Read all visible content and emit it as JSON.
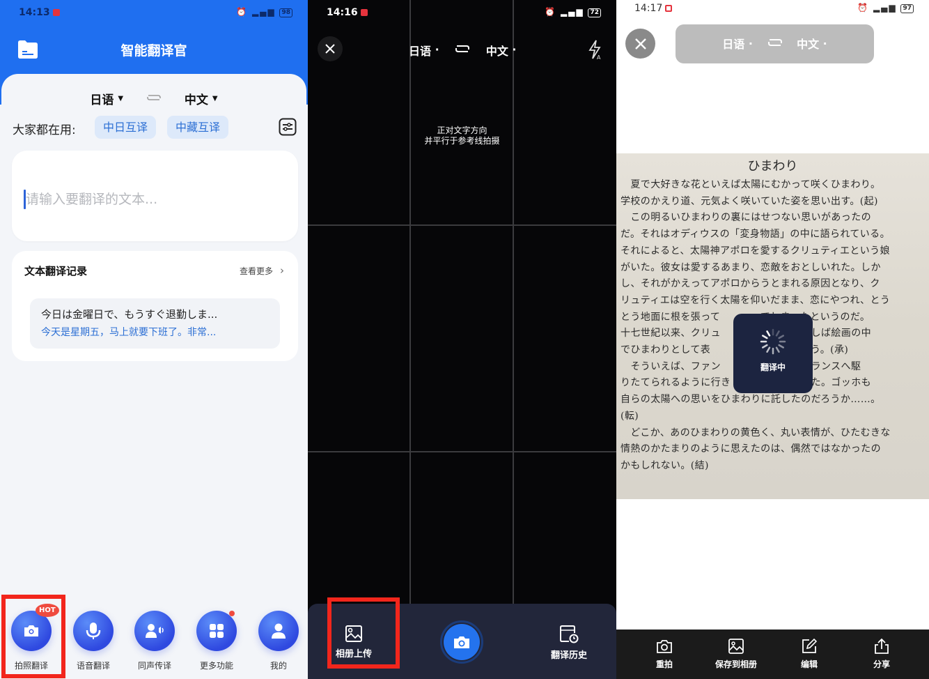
{
  "panel1": {
    "status": {
      "time": "14:13",
      "battery": "98"
    },
    "header": {
      "title": "智能翻译官",
      "folder_icon": "folder-icon"
    },
    "languages": {
      "source": "日语",
      "target": "中文",
      "swap_icon": "swap-icon"
    },
    "common": {
      "label": "大家都在用:",
      "chips": [
        "中日互译",
        "中藏互译"
      ],
      "settings_icon": "settings-sliders-icon"
    },
    "input": {
      "placeholder": "请输入要翻译的文本...",
      "value": ""
    },
    "history": {
      "title": "文本翻译记录",
      "more_label": "查看更多",
      "items": [
        {
          "source": "今日は金曜日で、もうすぐ退勤しま...",
          "translation": "今天是星期五，马上就要下班了。非常..."
        }
      ]
    },
    "tabs": [
      {
        "label": "拍照翻译",
        "icon": "camera-icon",
        "badge": "HOT"
      },
      {
        "label": "语音翻译",
        "icon": "microphone-icon"
      },
      {
        "label": "同声传译",
        "icon": "speaker-person-icon"
      },
      {
        "label": "更多功能",
        "icon": "grid-icon",
        "dot": true
      },
      {
        "label": "我的",
        "icon": "user-icon"
      }
    ],
    "colors": {
      "brand": "#1f6ff0",
      "highlight": "#f2261c"
    }
  },
  "panel2": {
    "status": {
      "time": "14:16",
      "battery": "72"
    },
    "languages": {
      "source": "日语",
      "target": "中文"
    },
    "hint": [
      "正对文字方向",
      "并平行于参考线拍摄"
    ],
    "bottom": {
      "album_label": "相册上传",
      "history_label": "翻译历史",
      "shutter_icon": "camera-shutter-icon"
    }
  },
  "panel3": {
    "status": {
      "time": "14:17",
      "battery": "97"
    },
    "languages": {
      "source": "日语",
      "target": "中文"
    },
    "document": {
      "title": "ひまわり",
      "lines": [
        "　夏で大好きな花といえば太陽にむかって咲くひまわり。",
        "学校のかえり道、元気よく咲いていた姿を思い出す。(起)",
        "　この明るいひまわりの裏にはせつない思いがあったの",
        "だ。それはオディウスの「変身物語」の中に語られている。",
        "それによると、太陽神アポロを愛するクリュティエという娘",
        "がいた。彼女は愛するあまり、恋敵をおとしいれた。しか",
        "し、それがかえってアポロからうとまれる原因となり、ク",
        "リュティエは空を行く太陽を仰いだまま、恋にやつれ、とう",
        "とう地面に根を張って　　　　てしまったというのだ。",
        "十七世紀以来、クリュ　　　　の花はしばしば絵画の中",
        "でひまわりとして表　　　　　なったという。(承)",
        "　そういえば、ファン　　　　に憧れ南フランスへ駆",
        "りたてられるように行き　　　の絵を描いた。ゴッホも",
        "自らの太陽への思いをひまわりに託したのだろうか……。",
        "(転)",
        "　どこか、あのひまわりの黄色く、丸い表情が、ひたむきな",
        "情熱のかたまりのように思えたのは、偶然ではなかったの",
        "かもしれない。(結)"
      ]
    },
    "loading_text": "翻译中",
    "bottom": [
      {
        "label": "重拍",
        "icon": "retake-camera-icon"
      },
      {
        "label": "保存到相册",
        "icon": "save-image-icon"
      },
      {
        "label": "编辑",
        "icon": "edit-icon"
      },
      {
        "label": "分享",
        "icon": "share-icon"
      }
    ]
  }
}
